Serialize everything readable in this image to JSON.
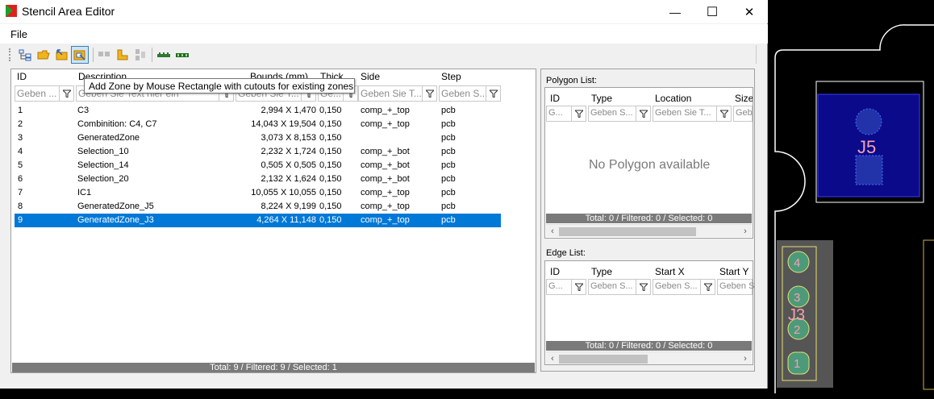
{
  "window": {
    "title": "Stencil Area Editor",
    "minimize": "—",
    "maximize": "☐",
    "close": "✕"
  },
  "menu": {
    "file": "File"
  },
  "tooltip": "Add Zone by Mouse Rectangle with cutouts for existing zones",
  "zones": {
    "columns": [
      "ID",
      "Description",
      "Bounds (mm)",
      "Thick",
      "Side",
      "Step"
    ],
    "filters": [
      "Geben ...",
      "Geben Sie Text hier ein",
      "Geben Sie T...",
      "Ge...",
      "Geben Sie T...",
      "Geben S..."
    ],
    "rows": [
      [
        "1",
        "C3",
        "2,994 X 1,470",
        "0,150",
        "comp_+_top",
        "pcb"
      ],
      [
        "2",
        "Combinition: C4, C7",
        "14,043 X 19,504",
        "0,150",
        "comp_+_top",
        "pcb"
      ],
      [
        "3",
        "GeneratedZone",
        "3,073 X 8,153",
        "0,150",
        "",
        "pcb"
      ],
      [
        "4",
        "Selection_10",
        "2,232 X 1,724",
        "0,150",
        "comp_+_bot",
        "pcb"
      ],
      [
        "5",
        "Selection_14",
        "0,505 X 0,505",
        "0,150",
        "comp_+_bot",
        "pcb"
      ],
      [
        "6",
        "Selection_20",
        "2,132 X 1,624",
        "0,150",
        "comp_+_bot",
        "pcb"
      ],
      [
        "7",
        "IC1",
        "10,055 X 10,055",
        "0,150",
        "comp_+_top",
        "pcb"
      ],
      [
        "8",
        "GeneratedZone_J5",
        "8,224 X 9,199",
        "0,150",
        "comp_+_top",
        "pcb"
      ],
      [
        "9",
        "GeneratedZone_J3",
        "4,264 X 11,148",
        "0,150",
        "comp_+_top",
        "pcb"
      ]
    ],
    "selected_index": 8,
    "status": "Total: 9 / Filtered: 9 / Selected: 1"
  },
  "polygon_list": {
    "label": "Polygon List:",
    "columns": [
      "ID",
      "Type",
      "Location",
      "Size"
    ],
    "filters": [
      "G...",
      "Geben S...",
      "Geben Sie T...",
      "Geb"
    ],
    "empty": "No Polygon available",
    "status": "Total: 0 / Filtered: 0 / Selected: 0"
  },
  "edge_list": {
    "label": "Edge List:",
    "columns": [
      "ID",
      "Type",
      "Start X",
      "Start Y"
    ],
    "filters": [
      "G...",
      "Geben S...",
      "Geben S...",
      "Geben S"
    ],
    "status": "Total: 0 / Filtered: 0 / Selected: 0"
  },
  "pcb": {
    "j5_label": "J5",
    "j3_label": "J3",
    "pins": [
      "4",
      "3",
      "2",
      "1"
    ],
    "colors": {
      "board_edge": "#ffffff",
      "zone_blue": "#0a0a8a",
      "pad_green": "#4c9a7a",
      "silk": "#f4a0b0"
    }
  }
}
